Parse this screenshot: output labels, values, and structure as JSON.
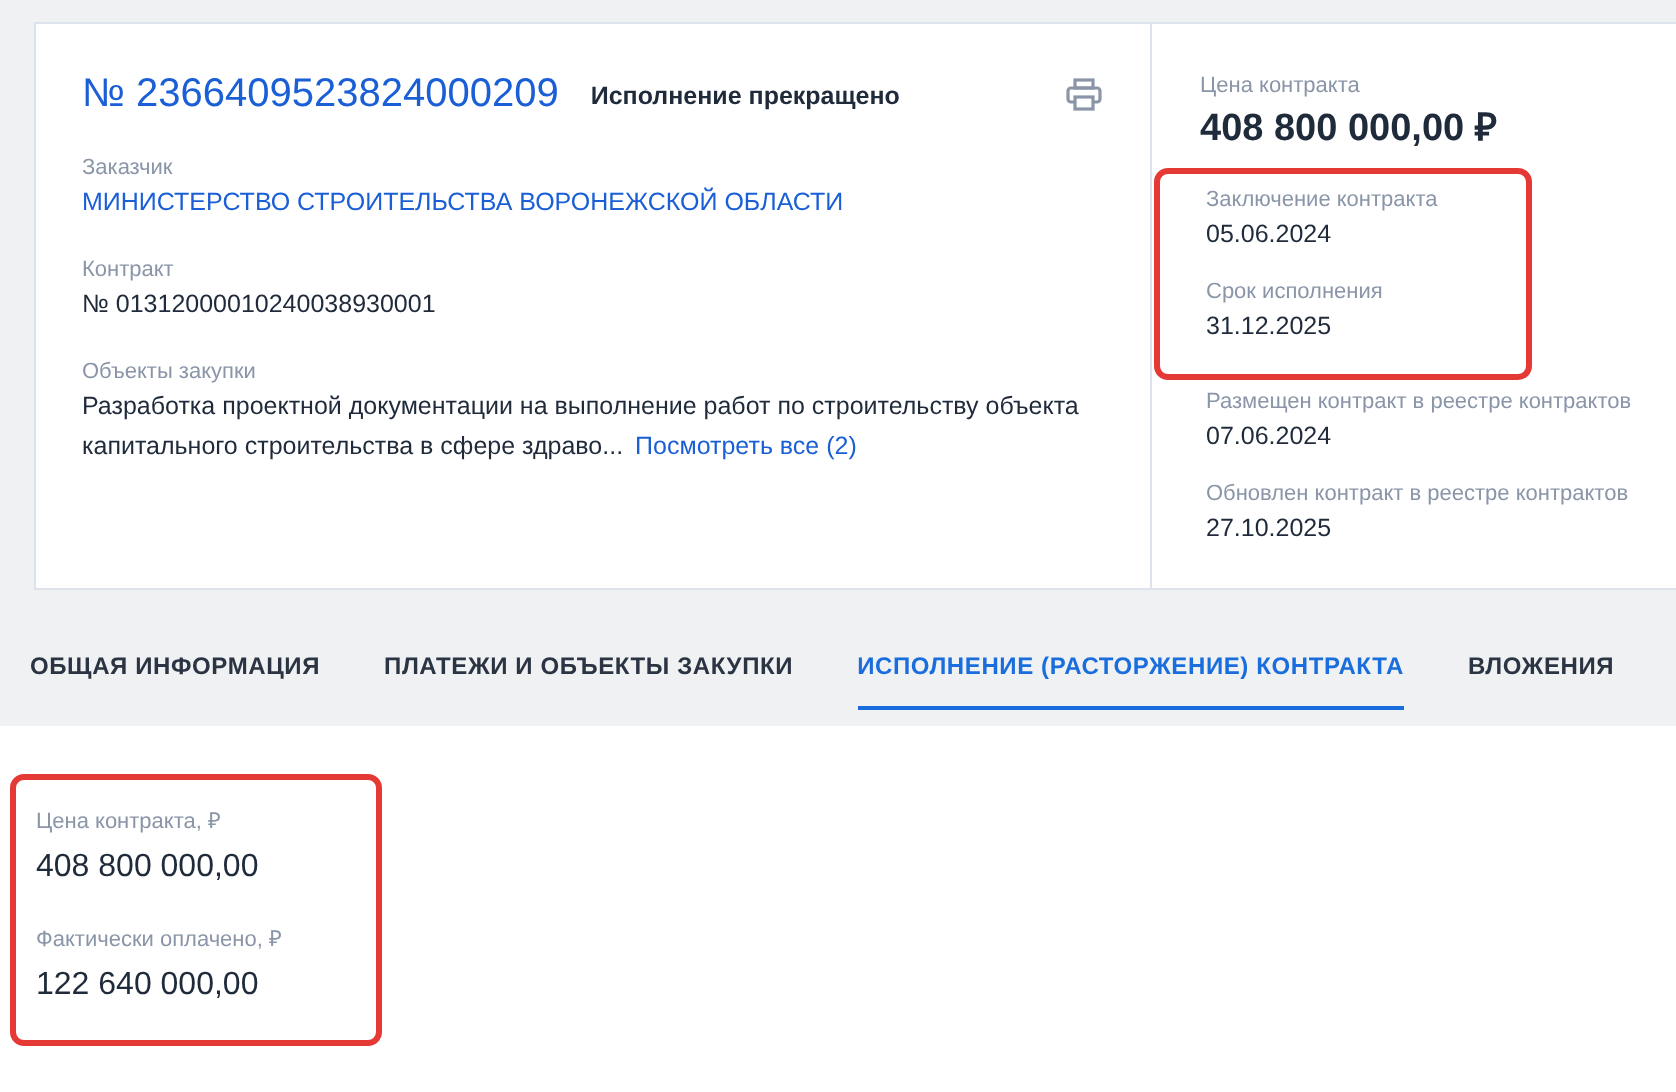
{
  "header": {
    "number": "№ 2366409523824000209",
    "status": "Исполнение прекращено"
  },
  "fields": [
    {
      "label": "Заказчик",
      "value": "МИНИСТЕРСТВО СТРОИТЕЛЬСТВА ВОРОНЕЖСКОЙ ОБЛАСТИ",
      "kind": "link"
    },
    {
      "label": "Контракт",
      "value": "№ 01312000010240038930001",
      "kind": "text"
    },
    {
      "label": "Объекты закупки",
      "value": "Разработка проектной документации на выполнение работ по строительству объекта капитального строительства в сфере здраво...",
      "kind": "text",
      "more": "Посмотреть все (2)"
    }
  ],
  "price": {
    "label": "Цена контракта",
    "value": "408 800 000,00 ₽"
  },
  "side_groups": [
    {
      "highlighted": true,
      "items": [
        {
          "label": "Заключение контракта",
          "value": "05.06.2024"
        },
        {
          "label": "Срок исполнения",
          "value": "31.12.2025"
        }
      ]
    },
    {
      "highlighted": false,
      "items": [
        {
          "label": "Размещен контракт в реестре контрактов",
          "value": "07.06.2024"
        },
        {
          "label": "Обновлен контракт в реестре контрактов",
          "value": "27.10.2025"
        }
      ]
    }
  ],
  "tabs": [
    {
      "label": "ОБЩАЯ ИНФОРМАЦИЯ",
      "selected": false
    },
    {
      "label": "ПЛАТЕЖИ И ОБЪЕКТЫ ЗАКУПКИ",
      "selected": false
    },
    {
      "label": "ИСПОЛНЕНИЕ (РАСТОРЖЕНИЕ) КОНТРАКТА",
      "selected": true
    },
    {
      "label": "ВЛОЖЕНИЯ",
      "selected": false
    }
  ],
  "summary": {
    "highlighted": true,
    "items": [
      {
        "label": "Цена контракта, ₽",
        "value": "408 800 000,00"
      },
      {
        "label": "Фактически оплачено, ₽",
        "value": "122 640 000,00"
      }
    ]
  }
}
